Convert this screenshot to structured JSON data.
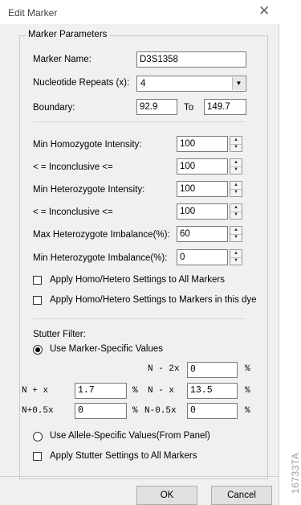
{
  "window": {
    "title": "Edit Marker",
    "close_glyph": "✕"
  },
  "group": {
    "title": "Marker Parameters"
  },
  "marker_name": {
    "label": "Marker Name:",
    "value": "D3S1358"
  },
  "repeats": {
    "label": "Nucleotide Repeats (x):",
    "value": "4"
  },
  "boundary": {
    "label": "Boundary:",
    "from": "92.9",
    "to_label": "To",
    "to": "149.7"
  },
  "intensity": {
    "min_homo_label": "Min Homozygote Intensity:",
    "min_homo": "100",
    "homo_inc_label": "< =  Inconclusive  <=",
    "homo_inc": "100",
    "min_hetero_label": "Min Heterozygote Intensity:",
    "min_hetero": "100",
    "hetero_inc_label": "< =  Inconclusive  <=",
    "hetero_inc": "100",
    "max_imb_label": "Max Heterozygote Imbalance(%):",
    "max_imb": "60",
    "min_imb_label": "Min Heterozygote Imbalance(%):",
    "min_imb": "0"
  },
  "checks": {
    "apply_all": "Apply Homo/Hetero Settings to All Markers",
    "apply_dye": "Apply Homo/Hetero Settings to Markers in this dye"
  },
  "stutter": {
    "label": "Stutter Filter:",
    "radio_marker": "Use Marker-Specific Values",
    "n_minus_2x_label": "N - 2x",
    "n_minus_2x": "0",
    "pct1": "%",
    "n_plus_x_label": "N + x",
    "n_plus_x": "1.7",
    "pct2": "%",
    "n_minus_x_label": "N - x",
    "n_minus_x": "13.5",
    "pct3": "%",
    "n_plus_05x_label": "N+0.5x",
    "n_plus_05x": "0",
    "pct4": "%",
    "n_minus_05x_label": "N-0.5x",
    "n_minus_05x": "0",
    "pct5": "%",
    "radio_allele": "Use Allele-Specific Values(From Panel)",
    "apply_all": "Apply Stutter Settings to All Markers"
  },
  "buttons": {
    "ok": "OK",
    "cancel": "Cancel"
  },
  "side_code": "16733TA"
}
